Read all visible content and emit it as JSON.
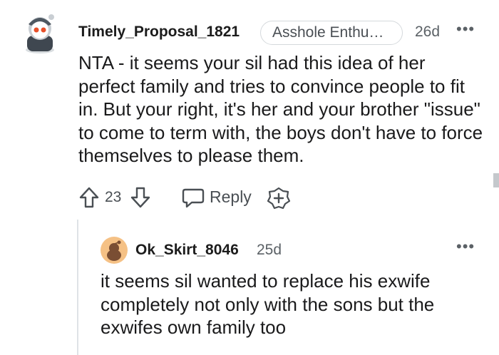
{
  "comment": {
    "username": "Timely_Proposal_1821",
    "flair": "Asshole Enthu…",
    "time": "26d",
    "more": "•••",
    "body": "NTA - it seems your sil had this idea of her perfect family and tries to convince people to fit in. But your right, it's her and your brother \"issue\" to come to term with, the boys don't have to force themselves to please them.",
    "vote_count": "23",
    "reply_label": "Reply"
  },
  "reply": {
    "username": "Ok_Skirt_8046",
    "time": "25d",
    "more": "•••",
    "body": "it seems sil wanted to replace his exwife completely not only with the sons but the exwifes own family too"
  },
  "icons": {
    "avatar": "snoo-avatar-icon",
    "upvote": "upvote-arrow-icon",
    "downvote": "downvote-arrow-icon",
    "reply": "speech-bubble-icon",
    "award": "add-award-icon"
  },
  "colors": {
    "avatar_accent": "#e8502a",
    "reply_avatar": "#f5c185"
  }
}
